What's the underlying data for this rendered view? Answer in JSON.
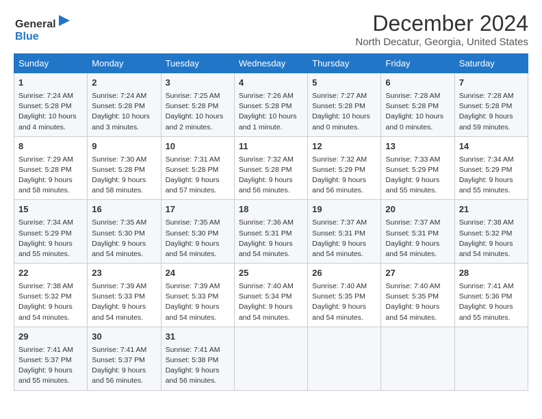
{
  "header": {
    "logo_line1": "General",
    "logo_line2": "Blue",
    "month": "December 2024",
    "location": "North Decatur, Georgia, United States"
  },
  "calendar": {
    "days_of_week": [
      "Sunday",
      "Monday",
      "Tuesday",
      "Wednesday",
      "Thursday",
      "Friday",
      "Saturday"
    ],
    "weeks": [
      [
        {
          "day": "1",
          "info": "Sunrise: 7:24 AM\nSunset: 5:28 PM\nDaylight: 10 hours and 4 minutes."
        },
        {
          "day": "2",
          "info": "Sunrise: 7:24 AM\nSunset: 5:28 PM\nDaylight: 10 hours and 3 minutes."
        },
        {
          "day": "3",
          "info": "Sunrise: 7:25 AM\nSunset: 5:28 PM\nDaylight: 10 hours and 2 minutes."
        },
        {
          "day": "4",
          "info": "Sunrise: 7:26 AM\nSunset: 5:28 PM\nDaylight: 10 hours and 1 minute."
        },
        {
          "day": "5",
          "info": "Sunrise: 7:27 AM\nSunset: 5:28 PM\nDaylight: 10 hours and 0 minutes."
        },
        {
          "day": "6",
          "info": "Sunrise: 7:28 AM\nSunset: 5:28 PM\nDaylight: 10 hours and 0 minutes."
        },
        {
          "day": "7",
          "info": "Sunrise: 7:28 AM\nSunset: 5:28 PM\nDaylight: 9 hours and 59 minutes."
        }
      ],
      [
        {
          "day": "8",
          "info": "Sunrise: 7:29 AM\nSunset: 5:28 PM\nDaylight: 9 hours and 58 minutes."
        },
        {
          "day": "9",
          "info": "Sunrise: 7:30 AM\nSunset: 5:28 PM\nDaylight: 9 hours and 58 minutes."
        },
        {
          "day": "10",
          "info": "Sunrise: 7:31 AM\nSunset: 5:28 PM\nDaylight: 9 hours and 57 minutes."
        },
        {
          "day": "11",
          "info": "Sunrise: 7:32 AM\nSunset: 5:28 PM\nDaylight: 9 hours and 56 minutes."
        },
        {
          "day": "12",
          "info": "Sunrise: 7:32 AM\nSunset: 5:29 PM\nDaylight: 9 hours and 56 minutes."
        },
        {
          "day": "13",
          "info": "Sunrise: 7:33 AM\nSunset: 5:29 PM\nDaylight: 9 hours and 55 minutes."
        },
        {
          "day": "14",
          "info": "Sunrise: 7:34 AM\nSunset: 5:29 PM\nDaylight: 9 hours and 55 minutes."
        }
      ],
      [
        {
          "day": "15",
          "info": "Sunrise: 7:34 AM\nSunset: 5:29 PM\nDaylight: 9 hours and 55 minutes."
        },
        {
          "day": "16",
          "info": "Sunrise: 7:35 AM\nSunset: 5:30 PM\nDaylight: 9 hours and 54 minutes."
        },
        {
          "day": "17",
          "info": "Sunrise: 7:35 AM\nSunset: 5:30 PM\nDaylight: 9 hours and 54 minutes."
        },
        {
          "day": "18",
          "info": "Sunrise: 7:36 AM\nSunset: 5:31 PM\nDaylight: 9 hours and 54 minutes."
        },
        {
          "day": "19",
          "info": "Sunrise: 7:37 AM\nSunset: 5:31 PM\nDaylight: 9 hours and 54 minutes."
        },
        {
          "day": "20",
          "info": "Sunrise: 7:37 AM\nSunset: 5:31 PM\nDaylight: 9 hours and 54 minutes."
        },
        {
          "day": "21",
          "info": "Sunrise: 7:38 AM\nSunset: 5:32 PM\nDaylight: 9 hours and 54 minutes."
        }
      ],
      [
        {
          "day": "22",
          "info": "Sunrise: 7:38 AM\nSunset: 5:32 PM\nDaylight: 9 hours and 54 minutes."
        },
        {
          "day": "23",
          "info": "Sunrise: 7:39 AM\nSunset: 5:33 PM\nDaylight: 9 hours and 54 minutes."
        },
        {
          "day": "24",
          "info": "Sunrise: 7:39 AM\nSunset: 5:33 PM\nDaylight: 9 hours and 54 minutes."
        },
        {
          "day": "25",
          "info": "Sunrise: 7:40 AM\nSunset: 5:34 PM\nDaylight: 9 hours and 54 minutes."
        },
        {
          "day": "26",
          "info": "Sunrise: 7:40 AM\nSunset: 5:35 PM\nDaylight: 9 hours and 54 minutes."
        },
        {
          "day": "27",
          "info": "Sunrise: 7:40 AM\nSunset: 5:35 PM\nDaylight: 9 hours and 54 minutes."
        },
        {
          "day": "28",
          "info": "Sunrise: 7:41 AM\nSunset: 5:36 PM\nDaylight: 9 hours and 55 minutes."
        }
      ],
      [
        {
          "day": "29",
          "info": "Sunrise: 7:41 AM\nSunset: 5:37 PM\nDaylight: 9 hours and 55 minutes."
        },
        {
          "day": "30",
          "info": "Sunrise: 7:41 AM\nSunset: 5:37 PM\nDaylight: 9 hours and 56 minutes."
        },
        {
          "day": "31",
          "info": "Sunrise: 7:41 AM\nSunset: 5:38 PM\nDaylight: 9 hours and 56 minutes."
        },
        null,
        null,
        null,
        null
      ]
    ]
  }
}
